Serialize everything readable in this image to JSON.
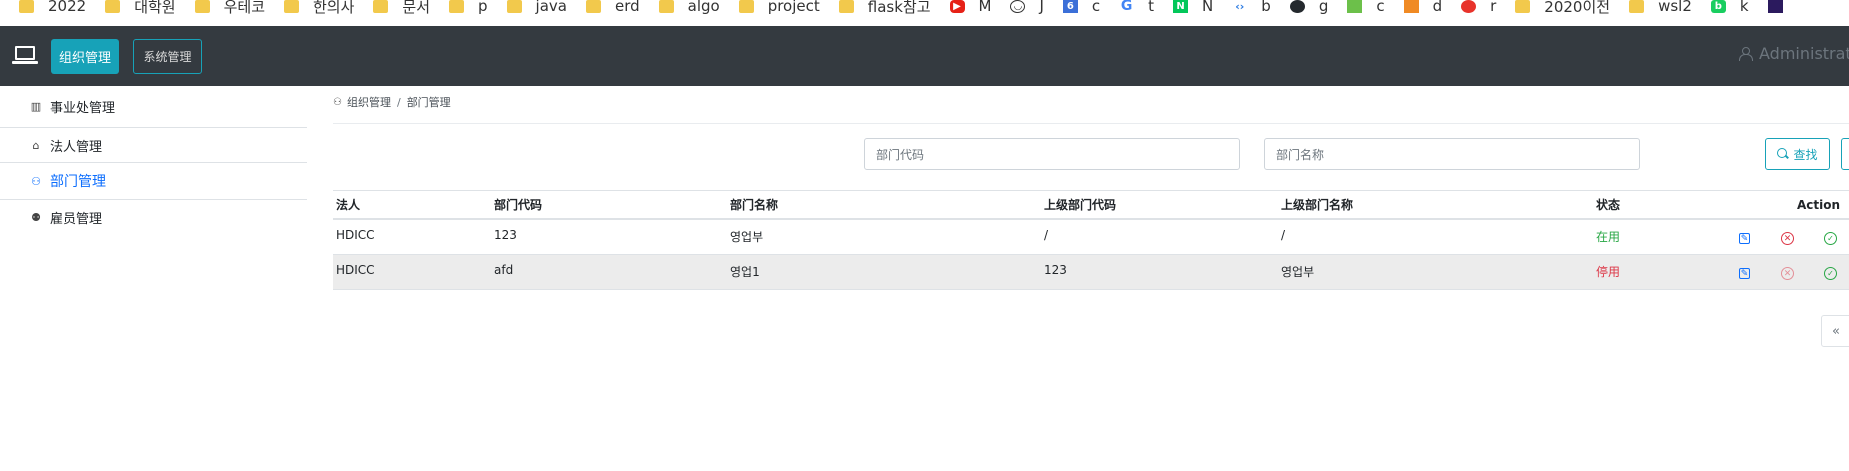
{
  "bookmarks": [
    {
      "label": "2022",
      "icon": "folder-icon"
    },
    {
      "label": "대학원",
      "icon": "folder-icon"
    },
    {
      "label": "우테코",
      "icon": "folder-icon"
    },
    {
      "label": "한의사",
      "icon": "folder-icon"
    },
    {
      "label": "문서",
      "icon": "folder-icon"
    },
    {
      "label": "p",
      "icon": "folder-icon"
    },
    {
      "label": "java",
      "icon": "folder-icon"
    },
    {
      "label": "erd",
      "icon": "folder-icon"
    },
    {
      "label": "algo",
      "icon": "folder-icon"
    },
    {
      "label": "project",
      "icon": "folder-icon"
    },
    {
      "label": "flask참고",
      "icon": "folder-icon"
    },
    {
      "label": "M",
      "icon": "youtube-icon"
    },
    {
      "label": "J",
      "icon": "smile-icon"
    },
    {
      "label": "c",
      "icon": "calendar-icon"
    },
    {
      "label": "t",
      "icon": "google-icon"
    },
    {
      "label": "N",
      "icon": "naver-icon"
    },
    {
      "label": "b",
      "icon": "code-icon"
    },
    {
      "label": "g",
      "icon": "github-icon"
    },
    {
      "label": "c",
      "icon": "recycle-icon"
    },
    {
      "label": "d",
      "icon": "grid-icon"
    },
    {
      "label": "r",
      "icon": "apple-icon"
    },
    {
      "label": "2020이전",
      "icon": "folder-icon"
    },
    {
      "label": "wsl2",
      "icon": "folder-icon"
    },
    {
      "label": "k",
      "icon": "blog-icon"
    },
    {
      "label": "",
      "icon": "app-icon"
    }
  ],
  "header": {
    "tab_org": "组织管理",
    "tab_sys": "系统管理",
    "user": "Administrator"
  },
  "sidebar": {
    "items": [
      {
        "label": "事业处管理",
        "icon": "building-icon"
      },
      {
        "label": "法人管理",
        "icon": "bank-icon"
      },
      {
        "label": "部门管理",
        "icon": "org-chart-icon"
      },
      {
        "label": "雇员管理",
        "icon": "people-icon"
      }
    ],
    "active_index": 2
  },
  "breadcrumb": {
    "root": "组织管理",
    "separator": "/",
    "current": "部门管理"
  },
  "search": {
    "code_placeholder": "部门代码",
    "name_placeholder": "部门名称",
    "search_label": "查找"
  },
  "table": {
    "columns": [
      "法人",
      "部门代码",
      "部门名称",
      "上级部门代码",
      "上级部门名称",
      "状态",
      "Action"
    ],
    "rows": [
      {
        "corp": "HDICC",
        "code": "123",
        "name": "영업부",
        "parent_code": "/",
        "parent_name": "/",
        "status": "在用",
        "status_type": "on"
      },
      {
        "corp": "HDICC",
        "code": "afd",
        "name": "영업1",
        "parent_code": "123",
        "parent_name": "영업부",
        "status": "停用",
        "status_type": "off"
      }
    ]
  },
  "pager": {
    "prev": "«"
  },
  "colors": {
    "accent": "#17a2b8",
    "navbar": "#343a40",
    "active_link": "#0d6efd",
    "status_on": "#28a745",
    "status_off": "#dc3545"
  }
}
